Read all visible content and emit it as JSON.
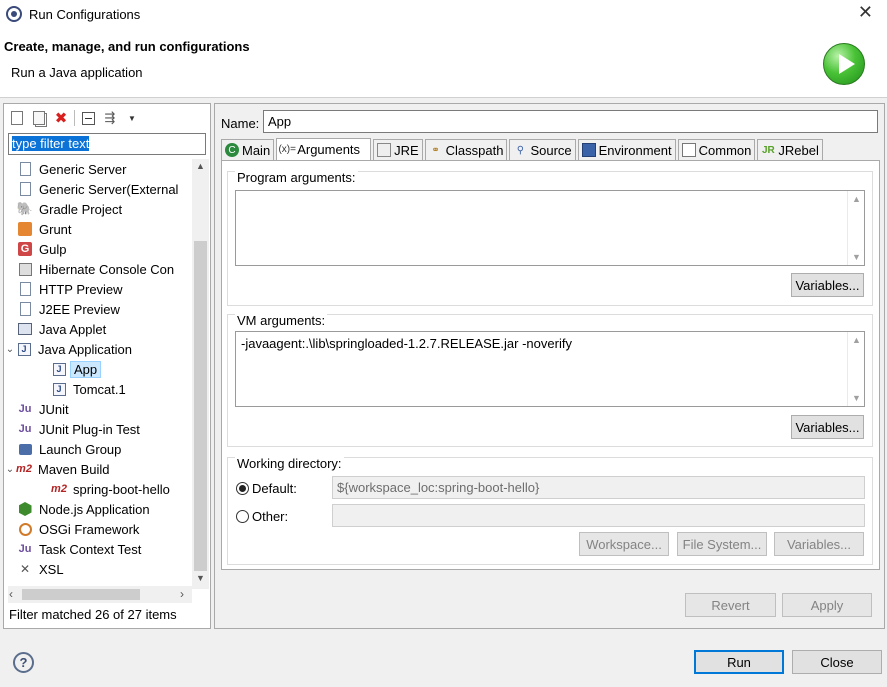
{
  "window": {
    "title": "Run Configurations",
    "banner_title": "Create, manage, and run configurations",
    "banner_subtitle": "Run a Java application",
    "banner_icon": "run-icon"
  },
  "left": {
    "filter_text": "type filter text",
    "tree": [
      {
        "label": "Generic Server",
        "icon": "server-icon",
        "level": 1,
        "twisty": ""
      },
      {
        "label": "Generic Server(External",
        "icon": "server-icon",
        "level": 1,
        "twisty": ""
      },
      {
        "label": "Gradle Project",
        "icon": "gradle-icon",
        "level": 1,
        "twisty": ""
      },
      {
        "label": "Grunt",
        "icon": "grunt-icon",
        "level": 1,
        "twisty": ""
      },
      {
        "label": "Gulp",
        "icon": "gulp-icon",
        "level": 1,
        "twisty": ""
      },
      {
        "label": "Hibernate Console Con",
        "icon": "hibernate-icon",
        "level": 1,
        "twisty": ""
      },
      {
        "label": "HTTP Preview",
        "icon": "page-icon",
        "level": 1,
        "twisty": ""
      },
      {
        "label": "J2EE Preview",
        "icon": "page-icon",
        "level": 1,
        "twisty": ""
      },
      {
        "label": "Java Applet",
        "icon": "applet-icon",
        "level": 1,
        "twisty": ""
      },
      {
        "label": "Java Application",
        "icon": "java-app-icon",
        "level": 1,
        "twisty": "v"
      },
      {
        "label": "App",
        "icon": "java-app-icon",
        "level": 2,
        "twisty": "",
        "selected": true
      },
      {
        "label": "Tomcat.1",
        "icon": "java-app-icon",
        "level": 2,
        "twisty": ""
      },
      {
        "label": "JUnit",
        "icon": "junit-icon",
        "level": 1,
        "twisty": ""
      },
      {
        "label": "JUnit Plug-in Test",
        "icon": "junit-plugin-icon",
        "level": 1,
        "twisty": ""
      },
      {
        "label": "Launch Group",
        "icon": "launch-group-icon",
        "level": 1,
        "twisty": ""
      },
      {
        "label": "Maven Build",
        "icon": "maven-icon",
        "level": 1,
        "twisty": "v"
      },
      {
        "label": "spring-boot-hello",
        "icon": "maven-icon",
        "level": 2,
        "twisty": ""
      },
      {
        "label": "Node.js Application",
        "icon": "nodejs-icon",
        "level": 1,
        "twisty": ""
      },
      {
        "label": "OSGi Framework",
        "icon": "osgi-icon",
        "level": 1,
        "twisty": ""
      },
      {
        "label": "Task Context Test",
        "icon": "junit-icon",
        "level": 1,
        "twisty": ""
      },
      {
        "label": "XSL",
        "icon": "xsl-icon",
        "level": 1,
        "twisty": ""
      }
    ],
    "status": "Filter matched 26 of 27 items"
  },
  "right": {
    "name_label": "Name:",
    "name_value": "App",
    "tabs": [
      {
        "label": "Main",
        "icon": "main-tab-icon"
      },
      {
        "label": "Arguments",
        "icon": "arguments-tab-icon"
      },
      {
        "label": "JRE",
        "icon": "jre-tab-icon"
      },
      {
        "label": "Classpath",
        "icon": "classpath-tab-icon"
      },
      {
        "label": "Source",
        "icon": "source-tab-icon"
      },
      {
        "label": "Environment",
        "icon": "environment-tab-icon"
      },
      {
        "label": "Common",
        "icon": "common-tab-icon"
      },
      {
        "label": "JRebel",
        "icon": "jrebel-tab-icon"
      }
    ],
    "active_tab": "Arguments",
    "program_args_label": "Program arguments:",
    "program_args_value": "",
    "vm_args_label": "VM arguments:",
    "vm_args_value": "-javaagent:.\\lib\\springloaded-1.2.7.RELEASE.jar -noverify",
    "variables_label": "Variables...",
    "working_dir_label": "Working directory:",
    "default_label": "Default:",
    "default_value": "${workspace_loc:spring-boot-hello}",
    "other_label": "Other:",
    "other_value": "",
    "workspace_btn": "Workspace...",
    "filesystem_btn": "File System...",
    "revert_btn": "Revert",
    "apply_btn": "Apply"
  },
  "footer": {
    "run_btn": "Run",
    "close_btn": "Close"
  }
}
